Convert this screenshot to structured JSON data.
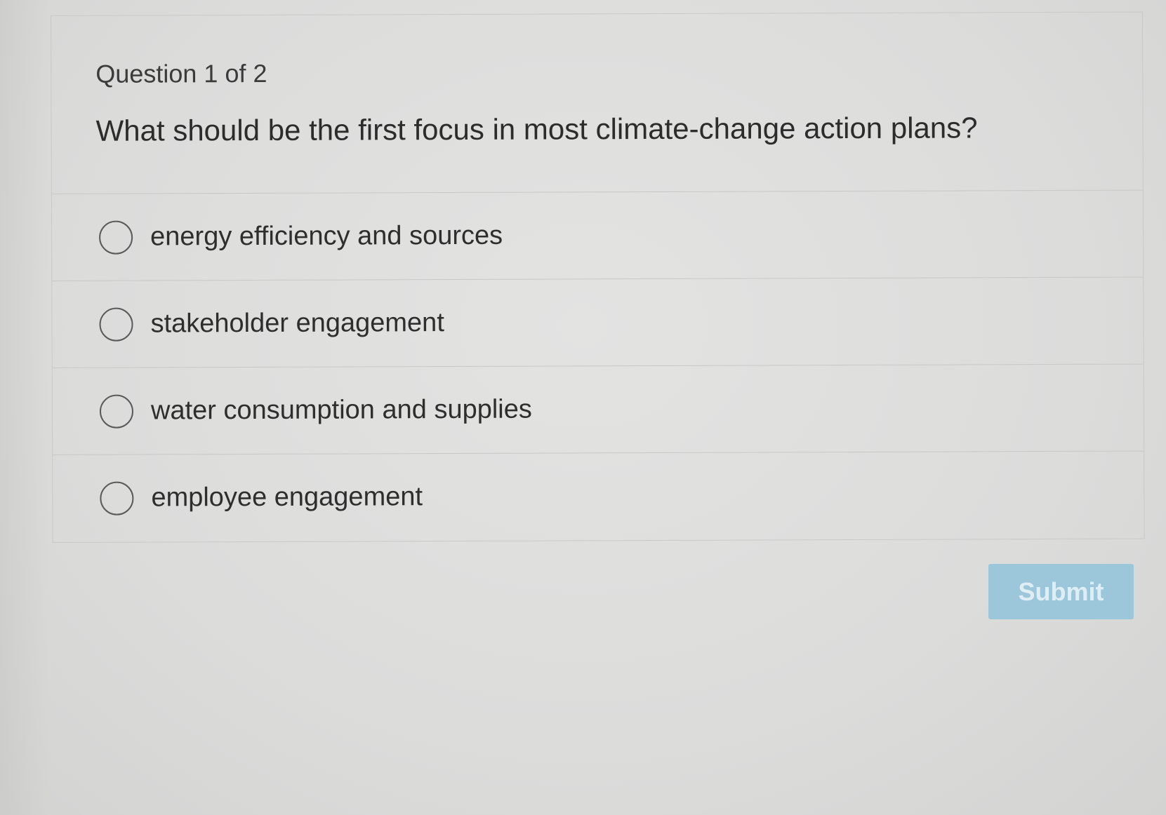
{
  "quiz": {
    "counter": "Question 1 of 2",
    "question": "What should be the first focus in most climate-change action plans?",
    "options": [
      {
        "label": "energy efficiency and sources",
        "selected": false
      },
      {
        "label": "stakeholder engagement",
        "selected": false
      },
      {
        "label": "water consumption and supplies",
        "selected": false
      },
      {
        "label": "employee engagement",
        "selected": false
      }
    ],
    "submit_label": "Submit",
    "submit_enabled": false
  },
  "colors": {
    "background": "#dedede",
    "text": "#2c2c2c",
    "submit_background": "#9cc6d9",
    "submit_text": "#dfeef5",
    "divider": "#c8c8c7"
  },
  "icons": {
    "radio": "radio-unchecked-icon"
  }
}
